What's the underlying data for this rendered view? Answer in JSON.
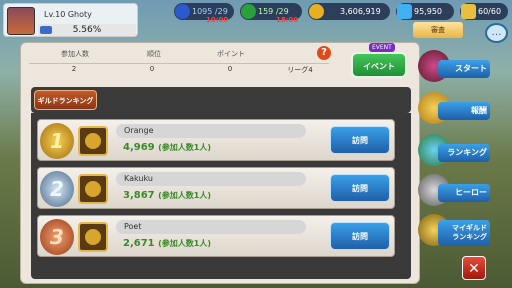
{
  "player": {
    "level": "Lv.10 Ghoty",
    "exp": "5.56%"
  },
  "resources": {
    "energy": "1095 /29",
    "energy_sub": "10:00",
    "stamina": "159 /29",
    "stamina_sub": "18:00",
    "gold": "3,606,919",
    "gems": "95,950",
    "trophies": "60/60"
  },
  "stats": {
    "headers": [
      "参加人数",
      "順位",
      "ポイント"
    ],
    "values": [
      "2",
      "0",
      "0",
      "リーグ4"
    ]
  },
  "event": {
    "tag": "EVENT",
    "label": "イベント"
  },
  "review_tab": "審査",
  "tab": "ギルドランキング",
  "rows": [
    {
      "rank": "1",
      "name": "Orange",
      "points": "4,969",
      "members": "(参加人数1人)",
      "visit": "訪問"
    },
    {
      "rank": "2",
      "name": "Kakuku",
      "points": "3,867",
      "members": "(参加人数1人)",
      "visit": "訪問"
    },
    {
      "rank": "3",
      "name": "Poet",
      "points": "2,671",
      "members": "(参加人数1人)",
      "visit": "訪問"
    }
  ],
  "side_menu": {
    "start": "スタート",
    "reward": "報酬",
    "ranking": "ランキング",
    "hero": "ヒーロー",
    "my_guild_line1": "マイギルド",
    "my_guild_line2": "ランキング"
  },
  "close": "✕",
  "help": "?"
}
